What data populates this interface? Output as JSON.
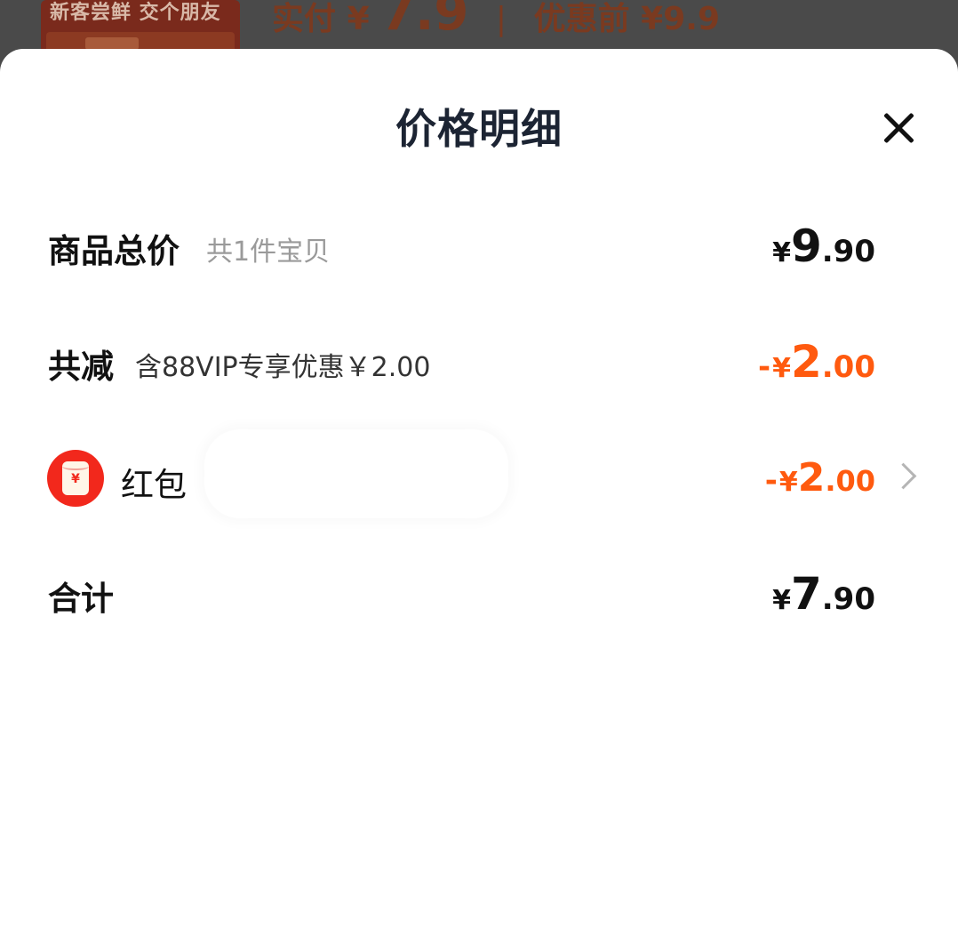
{
  "background": {
    "thumb_banner": "新客尝鲜 交个朋友",
    "paid_label": "实付",
    "paid_currency": "¥",
    "paid_value": "7.9",
    "separator": "|",
    "original_label": "优惠前",
    "original_value": "¥9.9"
  },
  "sheet": {
    "title": "价格明细",
    "close_icon": "close-icon"
  },
  "rows": {
    "goods_total": {
      "label": "商品总价",
      "sub": "共1件宝贝",
      "currency": "¥",
      "int": "9",
      "dec": ".90"
    },
    "discount": {
      "label": "共减",
      "sub": "含88VIP专享优惠￥2.00",
      "neg": "-",
      "currency": "¥",
      "int": "2",
      "dec": ".00"
    },
    "red_packet": {
      "icon": "red-packet-icon",
      "icon_glyph": "¥",
      "label": "红包",
      "neg": "-",
      "currency": "¥",
      "int": "2",
      "dec": ".00"
    },
    "total": {
      "label": "合计",
      "currency": "¥",
      "int": "7",
      "dec": ".90"
    }
  },
  "colors": {
    "accent_orange": "#ff5a0f",
    "red_packet": "#f2281c",
    "title": "#1c2433"
  }
}
